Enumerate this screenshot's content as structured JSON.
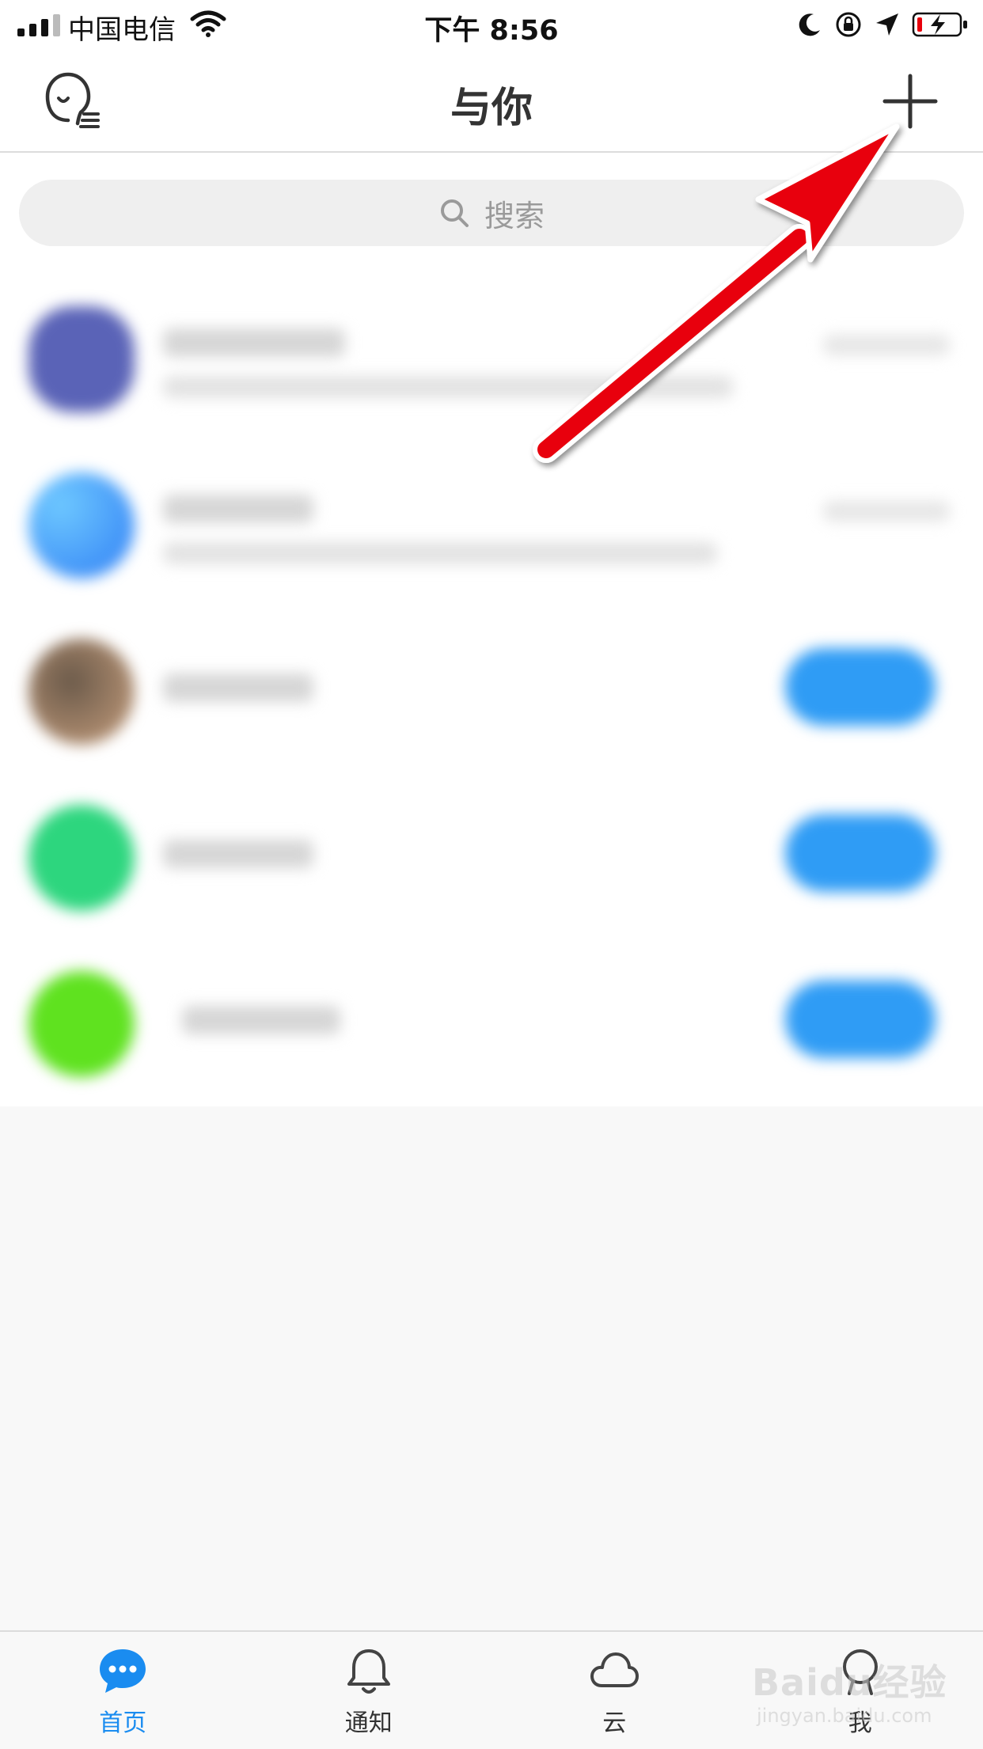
{
  "status_bar": {
    "carrier": "中国电信",
    "time": "下午 8:56"
  },
  "nav": {
    "title": "与你"
  },
  "search": {
    "placeholder": "搜索"
  },
  "conversations": [
    {
      "avatar_color": "#5a63b7",
      "has_time": true
    },
    {
      "avatar_color": "#3a8cf5",
      "has_time": true
    },
    {
      "avatar_color": "#8a7a6a",
      "has_action_button": true
    },
    {
      "avatar_color": "#2dd67e",
      "has_action_button": true
    },
    {
      "avatar_color": "#5fe21f",
      "has_action_button": true
    }
  ],
  "tabs": [
    {
      "label": "首页",
      "icon": "chat-bubble-icon",
      "active": true
    },
    {
      "label": "通知",
      "icon": "bell-icon",
      "active": false
    },
    {
      "label": "云",
      "icon": "cloud-icon",
      "active": false
    },
    {
      "label": "我",
      "icon": "person-icon",
      "active": false
    }
  ],
  "colors": {
    "accent": "#1a8cf0",
    "annotation_arrow": "#e8000b",
    "action_button": "#2f9cf5"
  },
  "watermark": {
    "logo": "Baidu经验",
    "url": "jingyan.baidu.com"
  }
}
